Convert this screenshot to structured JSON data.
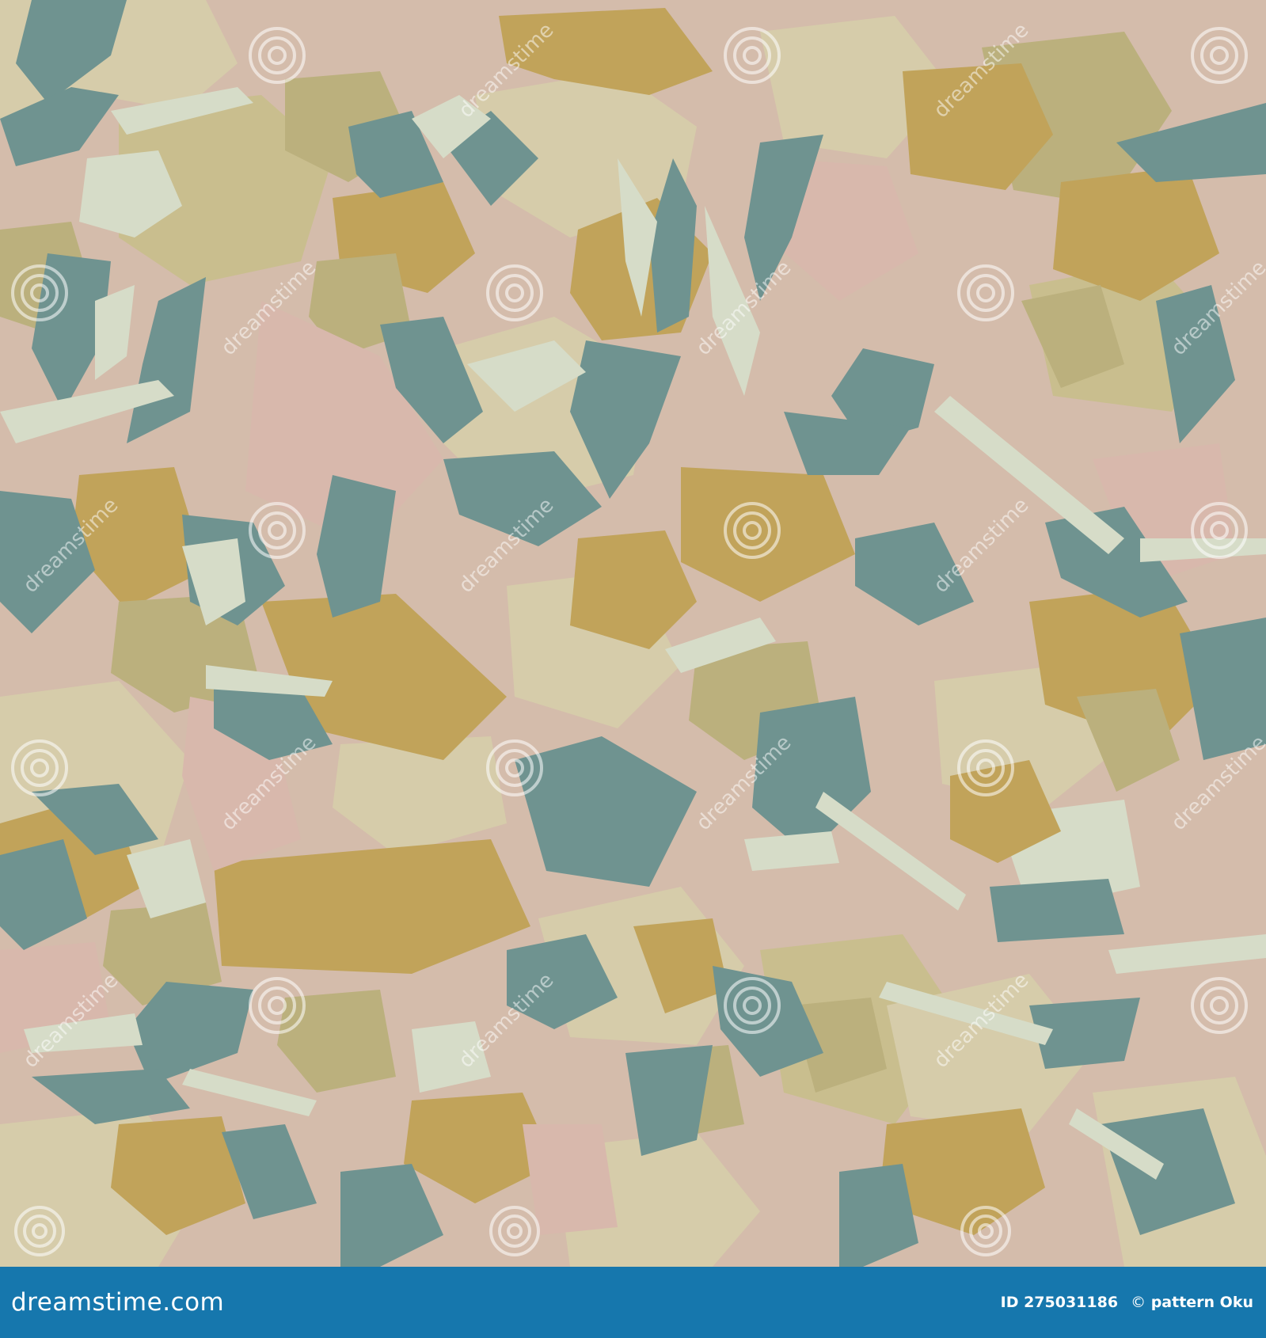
{
  "image": {
    "description_colors": {
      "background": "#d4bcab",
      "pink": "#d8b8ac",
      "teal": "#6f9390",
      "mustard": "#c1a35a",
      "olive": "#bbb07d",
      "sage_light": "#d6dcc8",
      "cream": "#d6ccaa",
      "khaki": "#c9be8e"
    },
    "watermark": {
      "text": "dreamstime",
      "icon": "spiral-logo-icon"
    }
  },
  "footer": {
    "logo_text": "dreamstime.com",
    "id_text": "ID 275031186",
    "copyright_symbol": "©",
    "author_text": "pattern Oku",
    "bar_color": "#1677ad"
  }
}
